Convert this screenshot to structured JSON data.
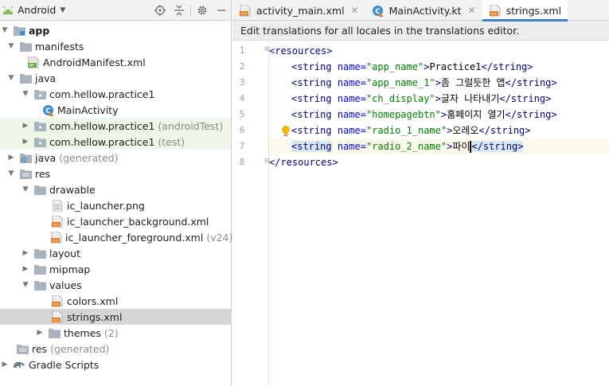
{
  "project": {
    "view_label": "Android",
    "items": [
      {
        "label": "app",
        "hint": ""
      },
      {
        "label": "manifests",
        "hint": ""
      },
      {
        "label": "AndroidManifest.xml",
        "hint": ""
      },
      {
        "label": "java",
        "hint": ""
      },
      {
        "label": "com.hellow.practice1",
        "hint": ""
      },
      {
        "label": "MainActivity",
        "hint": ""
      },
      {
        "label": "com.hellow.practice1",
        "hint": "(androidTest)"
      },
      {
        "label": "com.hellow.practice1",
        "hint": "(test)"
      },
      {
        "label": "java",
        "hint": "(generated)"
      },
      {
        "label": "res",
        "hint": ""
      },
      {
        "label": "drawable",
        "hint": ""
      },
      {
        "label": "ic_launcher.png",
        "hint": ""
      },
      {
        "label": "ic_launcher_background.xml",
        "hint": ""
      },
      {
        "label": "ic_launcher_foreground.xml",
        "hint": "(v24)"
      },
      {
        "label": "layout",
        "hint": ""
      },
      {
        "label": "mipmap",
        "hint": ""
      },
      {
        "label": "values",
        "hint": ""
      },
      {
        "label": "colors.xml",
        "hint": ""
      },
      {
        "label": "strings.xml",
        "hint": ""
      },
      {
        "label": "themes",
        "hint": "(2)"
      },
      {
        "label": "res",
        "hint": "(generated)"
      },
      {
        "label": "Gradle Scripts",
        "hint": ""
      }
    ]
  },
  "editor": {
    "tabs": [
      {
        "label": "activity_main.xml"
      },
      {
        "label": "MainActivity.kt"
      },
      {
        "label": "strings.xml"
      }
    ],
    "banner": "Edit translations for all locales in the translations editor.",
    "line_numbers": [
      "1",
      "2",
      "3",
      "4",
      "5",
      "6",
      "7",
      "8"
    ],
    "lines": [
      {
        "open": "<resources>"
      },
      {
        "name": "app_name",
        "value": "Practice1"
      },
      {
        "name": "app_name_1",
        "value": "좀 그럴듯한 앱"
      },
      {
        "name": "ch_display",
        "value": "글자 나타내기"
      },
      {
        "name": "homepagebtn",
        "value": "홈페이지 열기"
      },
      {
        "name": "radio_1_name",
        "value": "오레오"
      },
      {
        "name": "radio_2_name",
        "value": "파이"
      },
      {
        "close": "</resources>"
      }
    ],
    "syntax": {
      "string_open": "<string",
      "attr": "name=",
      "gt": ">",
      "string_close": "</string>"
    }
  },
  "colors": {
    "accent": "#4083c9",
    "green_row": "#eef6e7",
    "selected_row": "#d5d5d5",
    "tag": "#000080",
    "attr": "#0000ff",
    "value": "#008000"
  }
}
